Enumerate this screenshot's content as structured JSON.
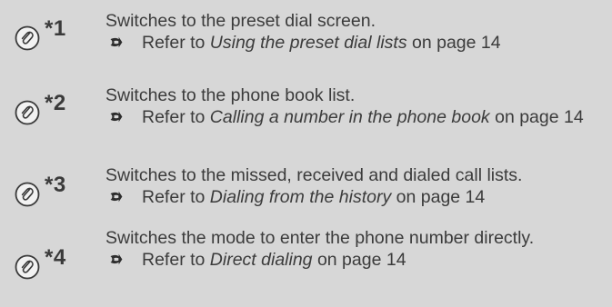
{
  "entries": [
    {
      "id": "*1",
      "description": "Switches to the preset dial screen.",
      "ref_prefix": "Refer to",
      "ref_title": "Using the preset dial lists",
      "ref_suffix": "on page 14"
    },
    {
      "id": "*2",
      "description": "Switches to the phone book list.",
      "ref_prefix": "Refer to",
      "ref_title": "Calling a number in the phone book",
      "ref_suffix": "on page 14"
    },
    {
      "id": "*3",
      "description": "Switches to the missed, received and dialed call lists.",
      "ref_prefix": "Refer to",
      "ref_title": "Dialing from the history",
      "ref_suffix": "on page 14"
    },
    {
      "id": "*4",
      "description": "Switches the mode to enter the phone number directly.",
      "ref_prefix": "Refer to",
      "ref_title": "Direct dialing",
      "ref_suffix": "on page 14"
    }
  ],
  "icons": {
    "marker": "paperclip-icon",
    "reference": "arrow-right-icon"
  },
  "colors": {
    "background": "#d7d7d7",
    "text": "#3b3b3b",
    "icon_fill": "#f2f2f2",
    "icon_stroke": "#3a3a3a"
  }
}
